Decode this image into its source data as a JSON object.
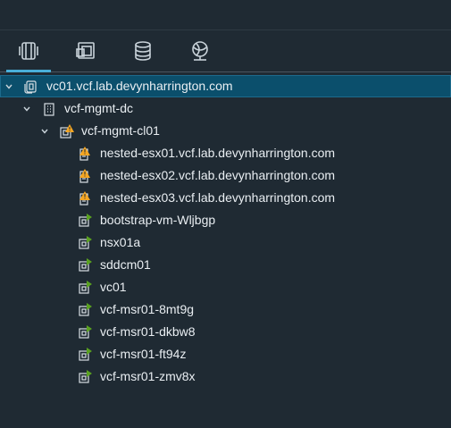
{
  "view_tabs": [
    {
      "icon": "hosts-clusters-icon",
      "active": true
    },
    {
      "icon": "vms-templates-icon",
      "active": false
    },
    {
      "icon": "storage-icon",
      "active": false
    },
    {
      "icon": "networking-icon",
      "active": false
    }
  ],
  "tree": {
    "vcenter": {
      "label": "vc01.vcf.lab.devynharrington.com",
      "icon": "vcenter-icon",
      "expanded": true,
      "selected": true
    },
    "datacenter": {
      "label": "vcf-mgmt-dc",
      "icon": "datacenter-icon",
      "expanded": true
    },
    "cluster": {
      "label": "vcf-mgmt-cl01",
      "icon": "cluster-warning-icon",
      "expanded": true
    },
    "hosts": [
      {
        "label": "nested-esx01.vcf.lab.devynharrington.com",
        "icon": "host-warning-icon"
      },
      {
        "label": "nested-esx02.vcf.lab.devynharrington.com",
        "icon": "host-warning-icon"
      },
      {
        "label": "nested-esx03.vcf.lab.devynharrington.com",
        "icon": "host-warning-icon"
      }
    ],
    "vms": [
      {
        "label": "bootstrap-vm-Wljbgp",
        "icon": "vm-powered-on-icon"
      },
      {
        "label": "nsx01a",
        "icon": "vm-powered-on-icon"
      },
      {
        "label": "sddcm01",
        "icon": "vm-powered-on-icon"
      },
      {
        "label": "vc01",
        "icon": "vm-powered-on-icon"
      },
      {
        "label": "vcf-msr01-8mt9g",
        "icon": "vm-powered-on-icon"
      },
      {
        "label": "vcf-msr01-dkbw8",
        "icon": "vm-powered-on-icon"
      },
      {
        "label": "vcf-msr01-ft94z",
        "icon": "vm-powered-on-icon"
      },
      {
        "label": "vcf-msr01-zmv8x",
        "icon": "vm-powered-on-icon"
      }
    ]
  },
  "colors": {
    "background": "#1f2a33",
    "selected_row": "#0b4f6c",
    "accent": "#49afd9",
    "warning": "#f5a623",
    "powered_on": "#5aa220",
    "text": "#e9eef2"
  }
}
